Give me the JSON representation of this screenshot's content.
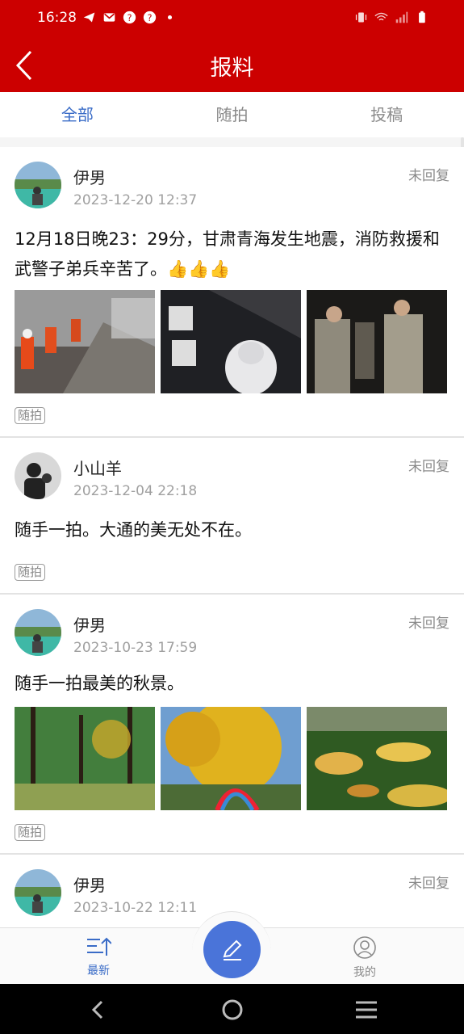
{
  "status_bar": {
    "time": "16:28",
    "icons_left": [
      "telegram-icon",
      "gmail-icon",
      "help-icon",
      "help-icon",
      "dot-icon"
    ],
    "icons_right": [
      "vibrate-icon",
      "wifi-off-icon",
      "signal-icon",
      "battery-icon"
    ]
  },
  "header": {
    "title": "报料",
    "back_icon": "chevron-left-icon",
    "bg_color": "#cc0000"
  },
  "tabs": [
    {
      "label": "全部",
      "active": true
    },
    {
      "label": "随拍",
      "active": false
    },
    {
      "label": "投稿",
      "active": false
    }
  ],
  "posts": [
    {
      "user": "伊男",
      "date": "2023-12-20 12:37",
      "status": "未回复",
      "content": "12月18日晚23：29分，甘肃青海发生地震，消防救援和武警子弟兵辛苦了。👍👍👍",
      "tag": "随拍",
      "images": [
        "firefighters-rubble-photo",
        "ping-an-poster-photo",
        "soldiers-night-photo"
      ]
    },
    {
      "user": "小山羊",
      "date": "2023-12-04 22:18",
      "status": "未回复",
      "content": "随手一拍。大通的美无处不在。",
      "tag": "随拍",
      "images": []
    },
    {
      "user": "伊男",
      "date": "2023-10-23 17:59",
      "status": "未回复",
      "content": "随手一拍最美的秋景。",
      "tag": "随拍",
      "images": [
        "autumn-forest-photo",
        "ginkgo-tree-photo",
        "fallen-leaves-photo"
      ]
    },
    {
      "user": "伊男",
      "date": "2023-10-22 12:11",
      "status": "未回复"
    }
  ],
  "bottom_nav": {
    "latest_label": "最新",
    "mine_label": "我的",
    "fab_icon": "pencil-icon",
    "active_color": "#3a6cc7"
  },
  "system_nav": [
    "back-icon",
    "home-icon",
    "menu-icon"
  ]
}
